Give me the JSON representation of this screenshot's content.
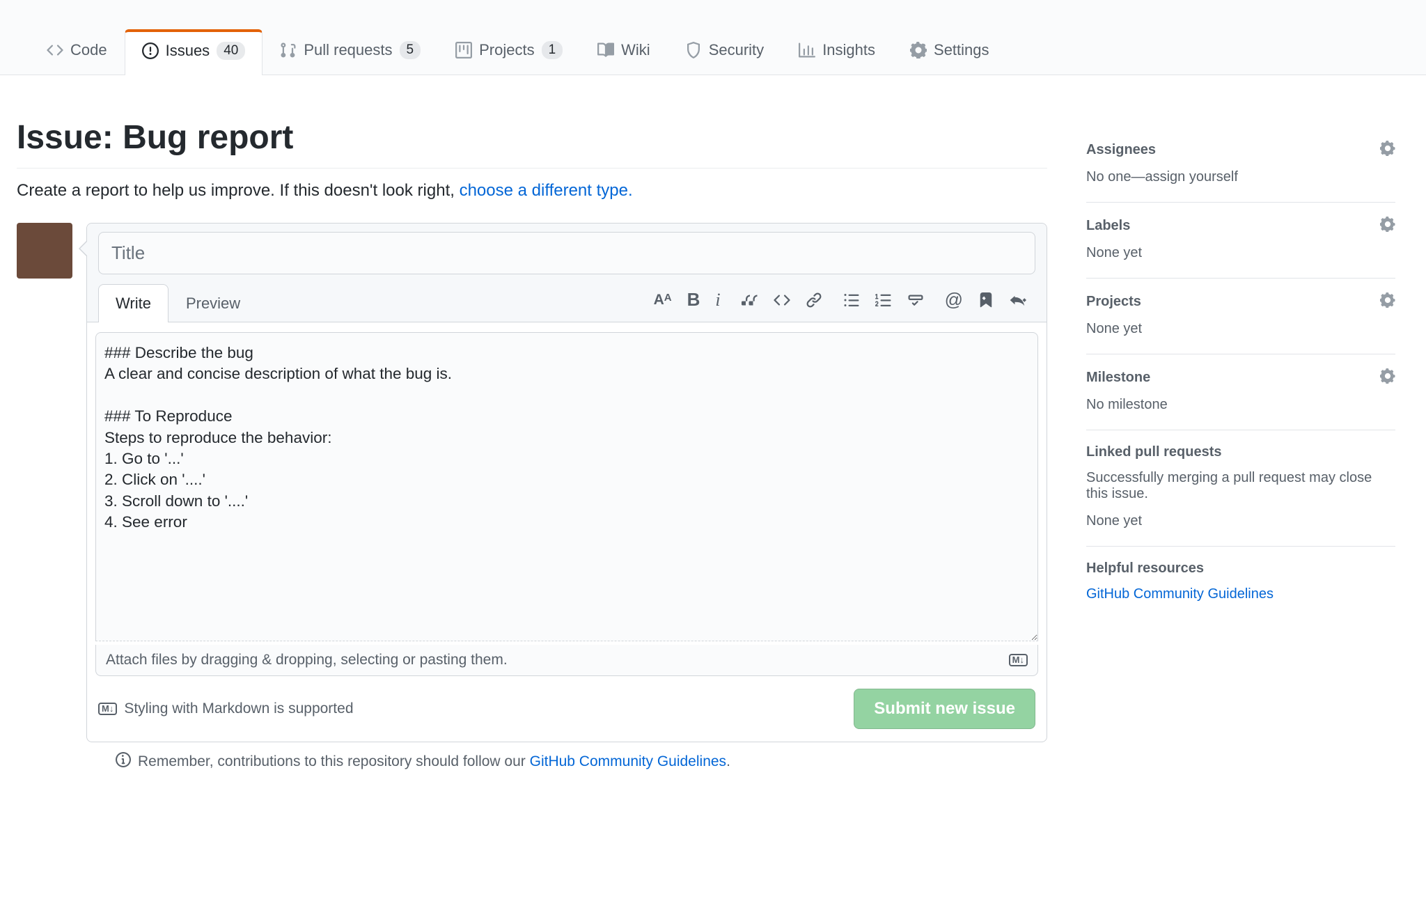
{
  "tabs": {
    "code": "Code",
    "issues": "Issues",
    "issues_count": "40",
    "pull_requests": "Pull requests",
    "pr_count": "5",
    "projects": "Projects",
    "projects_count": "1",
    "wiki": "Wiki",
    "security": "Security",
    "insights": "Insights",
    "settings": "Settings"
  },
  "page": {
    "heading": "Issue: Bug report",
    "subtitle_pre": "Create a report to help us improve. If this doesn't look right, ",
    "subtitle_link": "choose a different type.",
    "title_placeholder": "Title"
  },
  "editor": {
    "tab_write": "Write",
    "tab_preview": "Preview",
    "body_value": "### Describe the bug\nA clear and concise description of what the bug is.\n\n### To Reproduce\nSteps to reproduce the behavior:\n1. Go to '...'\n2. Click on '....'\n3. Scroll down to '....'\n4. See error\n",
    "attach_hint": "Attach files by dragging & dropping, selecting or pasting them.",
    "md_badge": "M↓",
    "md_text": "Styling with Markdown is supported",
    "submit_label": "Submit new issue"
  },
  "contrib": {
    "text_pre": "Remember, contributions to this repository should follow our ",
    "link": "GitHub Community Guidelines",
    "text_post": "."
  },
  "sidebar": {
    "assignees": {
      "title": "Assignees",
      "text": "No one—assign yourself"
    },
    "labels": {
      "title": "Labels",
      "text": "None yet"
    },
    "projects": {
      "title": "Projects",
      "text": "None yet"
    },
    "milestone": {
      "title": "Milestone",
      "text": "No milestone"
    },
    "linked_pr": {
      "title": "Linked pull requests",
      "desc": "Successfully merging a pull request may close this issue.",
      "text": "None yet"
    },
    "helpful": {
      "title": "Helpful resources",
      "link": "GitHub Community Guidelines"
    }
  }
}
